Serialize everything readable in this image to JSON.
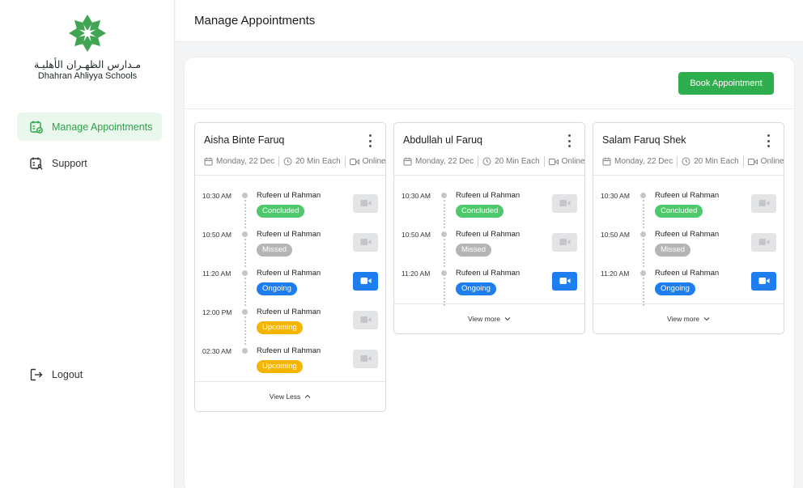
{
  "brand": {
    "name_ar": "مـدارس الظهـران الأهليـة",
    "name_en": "Dhahran Ahliyya Schools",
    "color": "#2fae4d"
  },
  "sidebar": {
    "items": [
      {
        "label": "Manage Appointments",
        "icon": "calendar-check-icon",
        "active": true
      },
      {
        "label": "Support",
        "icon": "calendar-user-icon",
        "active": false
      }
    ],
    "logout": {
      "label": "Logout",
      "icon": "logout-icon"
    }
  },
  "header": {
    "title": "Manage Appointments"
  },
  "toolbar": {
    "book_label": "Book Appointment"
  },
  "status_colors": {
    "Concluded": "#4cc96a",
    "Missed": "#b5b5b5",
    "Ongoing": "#1e7ef0",
    "Upcoming": "#f4b400"
  },
  "cards": [
    {
      "teacher": "Aisha Binte Faruq",
      "date": "Monday, 22 Dec",
      "duration": "20 Min Each",
      "mode": "Online",
      "slots": [
        {
          "time": "10:30 AM",
          "name": "Rufeen ul Rahman",
          "status": "Concluded"
        },
        {
          "time": "10:50 AM",
          "name": "Rufeen ul Rahman",
          "status": "Missed"
        },
        {
          "time": "11:20 AM",
          "name": "Rufeen ul Rahman",
          "status": "Ongoing"
        },
        {
          "time": "12:00 PM",
          "name": "Rufeen ul Rahman",
          "status": "Upcoming"
        },
        {
          "time": "02:30 AM",
          "name": "Rufeen ul Rahman",
          "status": "Upcoming"
        }
      ],
      "footer": "View Less"
    },
    {
      "teacher": "Abdullah ul Faruq",
      "date": "Monday, 22 Dec",
      "duration": "20 Min Each",
      "mode": "Online",
      "slots": [
        {
          "time": "10:30 AM",
          "name": "Rufeen ul Rahman",
          "status": "Concluded"
        },
        {
          "time": "10:50 AM",
          "name": "Rufeen ul Rahman",
          "status": "Missed"
        },
        {
          "time": "11:20 AM",
          "name": "Rufeen ul Rahman",
          "status": "Ongoing"
        }
      ],
      "footer": "View more"
    },
    {
      "teacher": "Salam Faruq Shek",
      "date": "Monday, 22 Dec",
      "duration": "20 Min Each",
      "mode": "Online",
      "slots": [
        {
          "time": "10:30 AM",
          "name": "Rufeen ul Rahman",
          "status": "Concluded"
        },
        {
          "time": "10:50 AM",
          "name": "Rufeen ul Rahman",
          "status": "Missed"
        },
        {
          "time": "11:20 AM",
          "name": "Rufeen ul Rahman",
          "status": "Ongoing"
        }
      ],
      "footer": "View more"
    }
  ]
}
